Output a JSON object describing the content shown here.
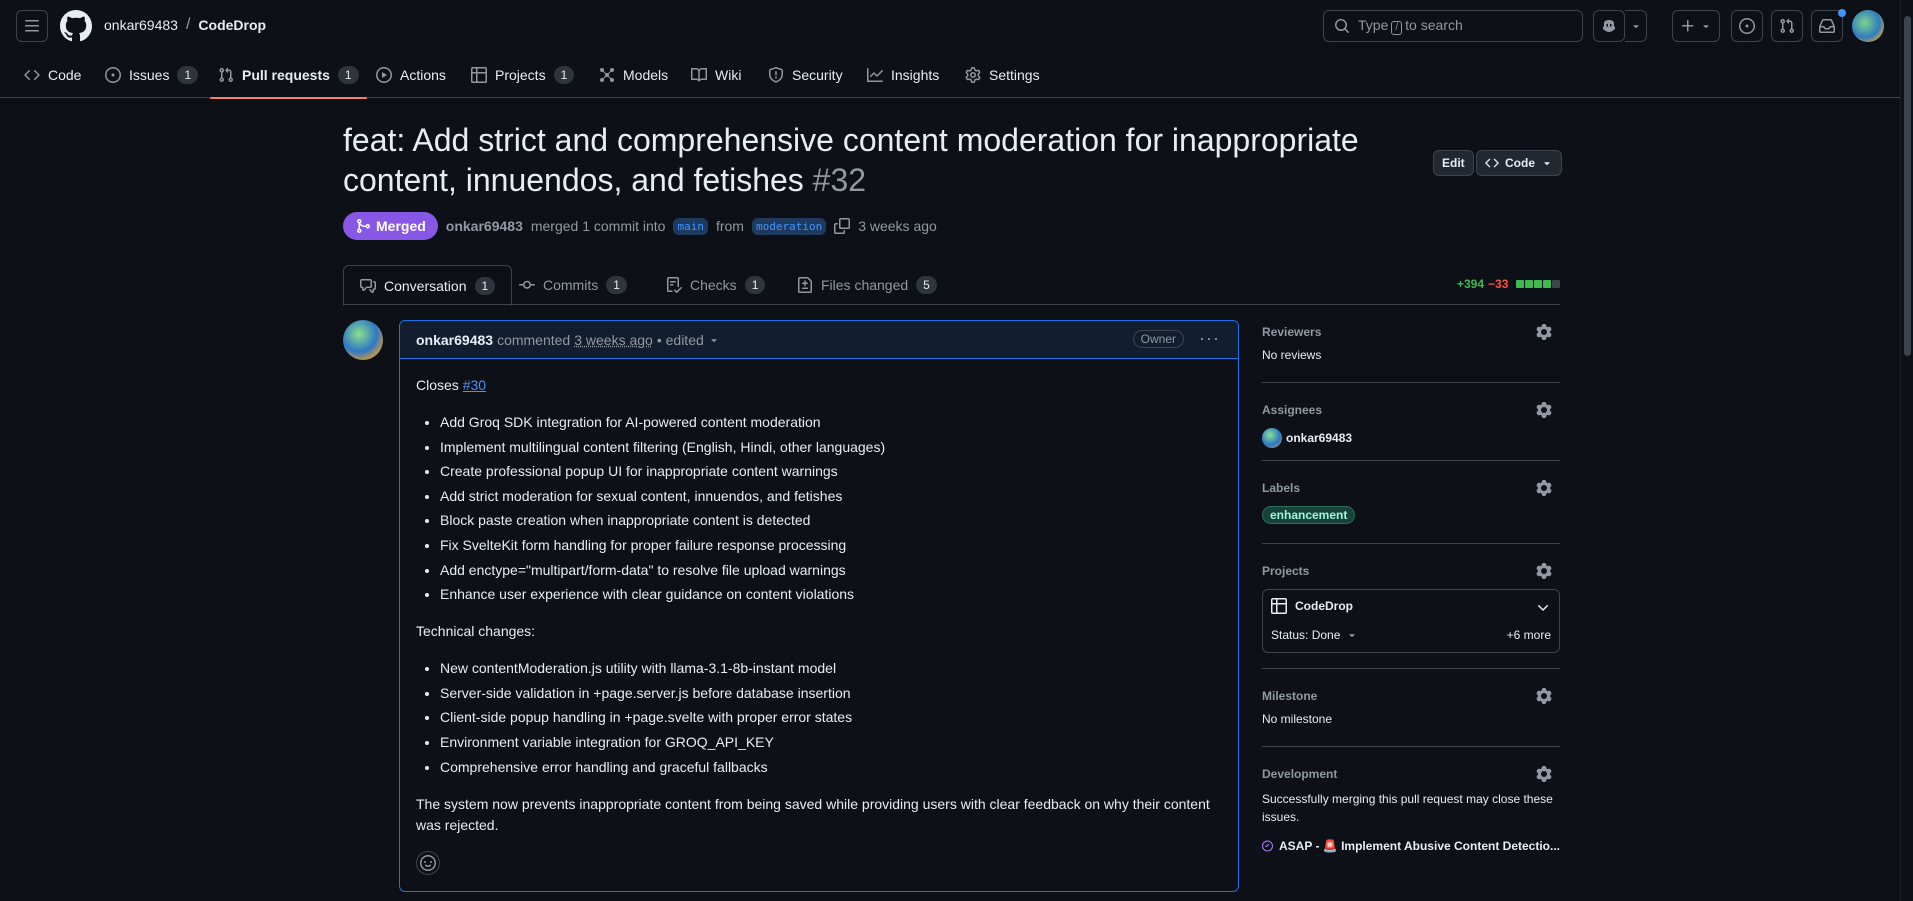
{
  "header": {
    "owner": "onkar69483",
    "separator": "/",
    "repo": "CodeDrop",
    "search_placeholder_pre": "Type",
    "search_key": "/",
    "search_placeholder_post": "to search"
  },
  "repo_nav": {
    "items": [
      {
        "label": "Code",
        "icon": "code-icon"
      },
      {
        "label": "Issues",
        "count": "1",
        "icon": "issue-icon"
      },
      {
        "label": "Pull requests",
        "count": "1",
        "icon": "pull-request-icon",
        "active": true
      },
      {
        "label": "Actions",
        "icon": "play-icon"
      },
      {
        "label": "Projects",
        "count": "1",
        "icon": "table-icon"
      },
      {
        "label": "Models",
        "icon": "models-icon"
      },
      {
        "label": "Wiki",
        "icon": "book-icon"
      },
      {
        "label": "Security",
        "icon": "shield-icon"
      },
      {
        "label": "Insights",
        "icon": "graph-icon"
      },
      {
        "label": "Settings",
        "icon": "gear-icon"
      }
    ]
  },
  "pr": {
    "title": "feat: Add strict and comprehensive content moderation for inappropriate content, innuendos, and fetishes",
    "number": "#32",
    "edit_label": "Edit",
    "code_label": "Code",
    "state": "Merged",
    "author": "onkar69483",
    "merge_text": "merged 1 commit into",
    "base_branch": "main",
    "from_text": "from",
    "head_branch": "moderation",
    "time_ago": "3 weeks ago",
    "state_color": "#8957e5"
  },
  "tabs": [
    {
      "label": "Conversation",
      "count": "1",
      "icon": "comment-discussion-icon"
    },
    {
      "label": "Commits",
      "count": "1",
      "icon": "commit-icon"
    },
    {
      "label": "Checks",
      "count": "1",
      "icon": "checklist-icon"
    },
    {
      "label": "Files changed",
      "count": "5",
      "icon": "file-diff-icon"
    }
  ],
  "diffstat": {
    "additions": "+394",
    "deletions": "−33"
  },
  "comment": {
    "author": "onkar69483",
    "action": "commented",
    "time": "3 weeks ago",
    "edited": "• edited",
    "role": "Owner",
    "closes_prefix": "Closes",
    "closes_link": "#30",
    "bullets": [
      "Add Groq SDK integration for AI-powered content moderation",
      "Implement multilingual content filtering (English, Hindi, other languages)",
      "Create professional popup UI for inappropriate content warnings",
      "Add strict moderation for sexual content, innuendos, and fetishes",
      "Block paste creation when inappropriate content is detected",
      "Fix SvelteKit form handling for proper failure response processing",
      "Add enctype=\"multipart/form-data\" to resolve file upload warnings",
      "Enhance user experience with clear guidance on content violations"
    ],
    "technical_heading": "Technical changes:",
    "technical_bullets": [
      "New contentModeration.js utility with llama-3.1-8b-instant model",
      "Server-side validation in +page.server.js before database insertion",
      "Client-side popup handling in +page.svelte with proper error states",
      "Environment variable integration for GROQ_API_KEY",
      "Comprehensive error handling and graceful fallbacks"
    ],
    "summary": "The system now prevents inappropriate content from being saved while providing users with clear feedback on why their content was rejected."
  },
  "sidebar": {
    "reviewers": {
      "title": "Reviewers",
      "value": "No reviews"
    },
    "assignees": {
      "title": "Assignees",
      "value": "onkar69483"
    },
    "labels": {
      "title": "Labels",
      "value": "enhancement"
    },
    "projects": {
      "title": "Projects",
      "name": "CodeDrop",
      "status": "Status: Done",
      "more": "+6 more"
    },
    "milestone": {
      "title": "Milestone",
      "value": "No milestone"
    },
    "development": {
      "title": "Development",
      "text": "Successfully merging this pull request may close these issues.",
      "issue": "ASAP - 🚨 Implement Abusive Content Detectio..."
    }
  }
}
